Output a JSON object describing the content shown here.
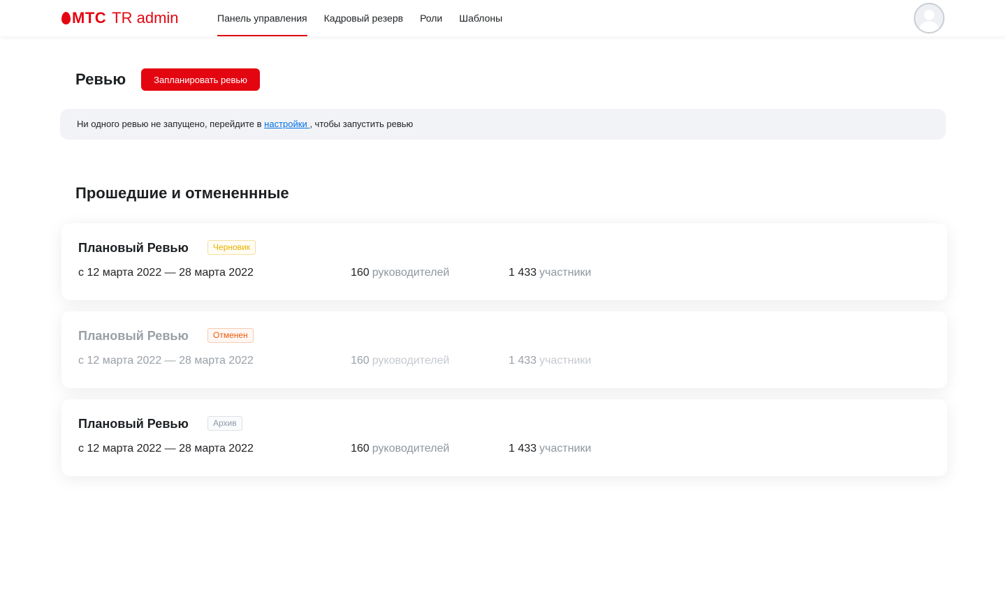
{
  "header": {
    "logo_mts": "МТС",
    "logo_suffix": "TR admin",
    "nav": [
      {
        "label": "Панель управления",
        "active": true
      },
      {
        "label": "Кадровый резерв",
        "active": false
      },
      {
        "label": "Роли",
        "active": false
      },
      {
        "label": "Шаблоны",
        "active": false
      }
    ]
  },
  "review": {
    "title": "Ревью",
    "plan_button": "Запланировать ревью",
    "notice_before": "Ни одного ревью не запущено, перейдите в ",
    "notice_link": "настройки ",
    "notice_after": ", чтобы запустить ревью"
  },
  "past": {
    "title": "Прошедшие и отмененнные",
    "cards": [
      {
        "title": "Плановый Ревью",
        "badge": "Черновик",
        "status": "draft",
        "dates": "с 12 марта 2022 — 28 марта 2022",
        "managers_count": "160",
        "managers_label": "руководителей",
        "participants_count": "1 433",
        "participants_label": "участники"
      },
      {
        "title": "Плановый Ревью",
        "badge": "Отменен",
        "status": "canceled",
        "dates": "с 12 марта 2022 — 28 марта 2022",
        "managers_count": "160",
        "managers_label": "руководителей",
        "participants_count": "1 433",
        "participants_label": "участники"
      },
      {
        "title": "Плановый Ревью",
        "badge": "Архив",
        "status": "archive",
        "dates": "с 12 марта 2022 — 28 марта 2022",
        "managers_count": "160",
        "managers_label": "руководителей",
        "participants_count": "1 433",
        "participants_label": "участники"
      }
    ]
  },
  "colors": {
    "brand_red": "#e30611",
    "link_blue": "#0070e5",
    "notice_bg": "#f2f3f7"
  }
}
